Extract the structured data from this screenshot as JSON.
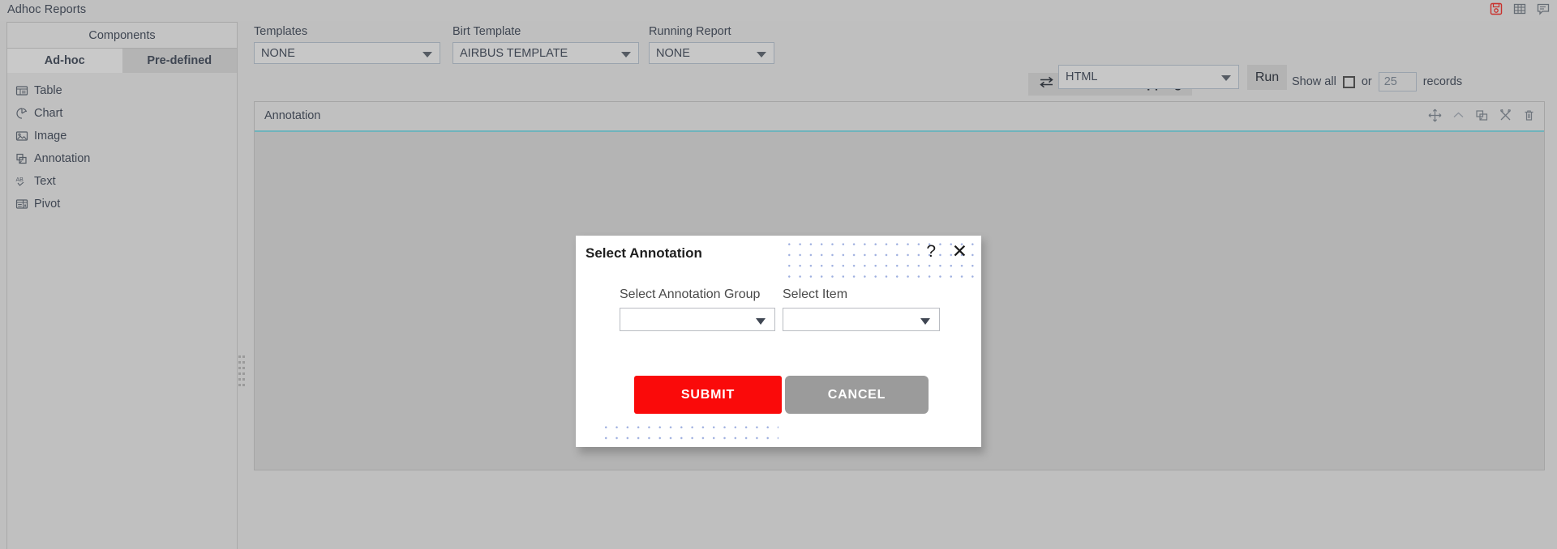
{
  "window": {
    "title": "Adhoc Reports",
    "icons": [
      {
        "name": "save-report-icon",
        "label": "Save Report"
      },
      {
        "name": "table-view-icon",
        "label": "Table View"
      },
      {
        "name": "comment-icon",
        "label": "Comments"
      }
    ]
  },
  "sidebar": {
    "header": "Components",
    "tabs": [
      {
        "label": "Ad-hoc",
        "active": true
      },
      {
        "label": "Pre-defined",
        "active": false
      }
    ],
    "items": [
      {
        "label": "Table",
        "icon": "table-icon"
      },
      {
        "label": "Chart",
        "icon": "pie-chart-icon"
      },
      {
        "label": "Image",
        "icon": "image-icon"
      },
      {
        "label": "Annotation",
        "icon": "annotation-icon"
      },
      {
        "label": "Text",
        "icon": "text-ab-icon"
      },
      {
        "label": "Pivot",
        "icon": "pivot-icon"
      }
    ]
  },
  "toolbar": {
    "templates": {
      "label": "Templates",
      "value": "NONE"
    },
    "birt_template": {
      "label": "Birt Template",
      "value": "AIRBUS TEMPLATE"
    },
    "running_report": {
      "label": "Running Report",
      "value": "NONE"
    },
    "parameter_mapping": {
      "label": "Parameter Mapping",
      "icon": "swap-arrows-icon"
    },
    "records": {
      "show_all_label": "Show all",
      "or_label": "or",
      "count_value": "25",
      "records_label": "records",
      "checked": false
    },
    "format": {
      "value": "HTML"
    },
    "run": {
      "label": "Run"
    }
  },
  "annotation_panel": {
    "title": "Annotation",
    "tools": [
      {
        "name": "move-icon",
        "label": "Move"
      },
      {
        "name": "collapse-chevron-up-icon",
        "label": "Collapse"
      },
      {
        "name": "duplicate-icon",
        "label": "Duplicate"
      },
      {
        "name": "settings-tools-icon",
        "label": "Settings"
      },
      {
        "name": "delete-trash-icon",
        "label": "Delete"
      }
    ]
  },
  "modal": {
    "title": "Select Annotation",
    "help_glyph": "?",
    "close_glyph": "✕",
    "fields": [
      {
        "label": "Select Annotation Group",
        "value": ""
      },
      {
        "label": "Select Item",
        "value": ""
      }
    ],
    "submit_label": "SUBMIT",
    "cancel_label": "CANCEL"
  },
  "colors": {
    "submit_red": "#fa0a0a",
    "cancel_gray": "#9b9b9b",
    "panel_gray": "#c0c0c0",
    "canvas_gray": "#b4b4b4",
    "accent_teal": "#6fb3bc",
    "save_icon_red": "#c9302c",
    "dot_pattern_blue": "#9fb0e0"
  }
}
